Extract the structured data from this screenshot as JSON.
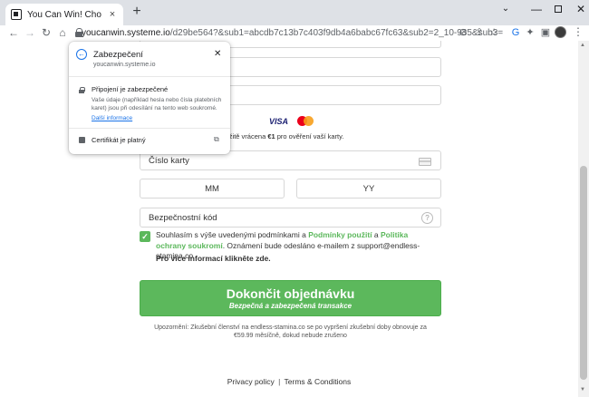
{
  "browser": {
    "tab_title": "You Can Win! Choose Your Prize",
    "tab_close": "×",
    "new_tab": "+",
    "url_host": "youcanwin.systeme.io",
    "url_rest": "/d29be564?&sub1=abcdb7c13b7c403f9db4a6babc67fc63&sub2=2_10-935&sub3=",
    "back_glyph": "←",
    "forward_glyph": "→",
    "reload_glyph": "↻",
    "home_glyph": "⌂",
    "icons": [
      "lock-icon",
      "eye-off-icon",
      "share-icon",
      "star-icon",
      "translate-icon",
      "extensions-icon",
      "sidepanel-icon",
      "profile-avatar",
      "menu-icon"
    ]
  },
  "site_info_popup": {
    "back_glyph": "←",
    "title": "Zabezpečení",
    "domain": "youcanwin.systeme.io",
    "close_glyph": "✕",
    "secure_title": "Připojení je zabezpečené",
    "secure_desc": "Vaše údaje (například hesla nebo čísla platebních karet) jsou při odesílání na tento web soukromé.",
    "learn_more": "Další informace",
    "certificate": "Certifikát je platný",
    "external_glyph": "⧉"
  },
  "payment": {
    "brands": [
      "VISA",
      "mastercard"
    ],
    "notice_pre": "tní karty bude stržena a okamžitě vrácena ",
    "notice_amount": "€1",
    "notice_post": " pro ověření vaší karty.",
    "card_number_placeholder": "Číslo karty",
    "month_placeholder": "MM",
    "year_placeholder": "YY",
    "cvc_placeholder": "Bezpečnostní kód",
    "help_glyph": "?",
    "consent_pre": "Souhlasím s výše uvedenými podmínkami a ",
    "consent_terms": "Podmínky použití",
    "consent_and": " a ",
    "consent_privacy": "Politika ochrany soukromí",
    "consent_post": ". Oznámení bude odesláno e-mailem z support@endless-stamina.co",
    "more_info": "Pro více informací klikněte zde.",
    "submit_main": "Dokončit objednávku",
    "submit_sub": "Bezpečná a zabezpečená transakce",
    "warning": "Upozornění: Zkušební členství na endless-stamina.co se po vypršení zkušební doby obnovuje za €59.99 měsíčně, dokud nebude zrušeno"
  },
  "footer": {
    "privacy": "Privacy policy",
    "separator": "|",
    "terms": "Terms & Conditions"
  },
  "colors": {
    "accent_green": "#5cb85c",
    "link_blue": "#1a73e8",
    "tabstrip": "#dee1e6"
  }
}
